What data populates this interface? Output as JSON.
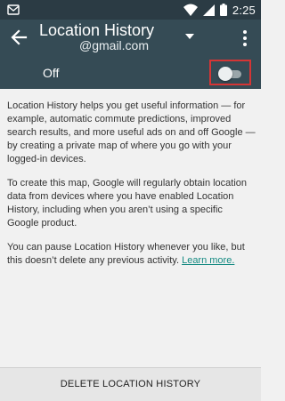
{
  "status_bar": {
    "time": "2:25",
    "icons": [
      "notification-icon",
      "wifi-icon",
      "signal-icon",
      "battery-icon"
    ]
  },
  "app_bar": {
    "title": "Location History",
    "account": "@gmail.com",
    "icons": [
      "back-arrow-icon",
      "chevron-down-icon",
      "more-vert-icon"
    ]
  },
  "toggle": {
    "label": "Off",
    "state": "off"
  },
  "content": {
    "paragraph_1": "Location History helps you get useful information — for example, automatic commute predictions, improved search results, and more useful ads on and off Google — by creating a private map of where you go with your logged-in devices.",
    "paragraph_2": "To create this map, Google will regularly obtain location data from devices where you have enabled Location History, including when you aren’t using a specific Google product.",
    "paragraph_3": "You can pause Location History whenever you like, but this doesn’t delete any previous activity.",
    "learn_more": "Learn more."
  },
  "bottom": {
    "delete_label": "DELETE LOCATION HISTORY"
  },
  "colors": {
    "status_bar": "#2b3b44",
    "app_bar": "#354b55",
    "link": "#158a82",
    "highlight": "#d43535"
  }
}
